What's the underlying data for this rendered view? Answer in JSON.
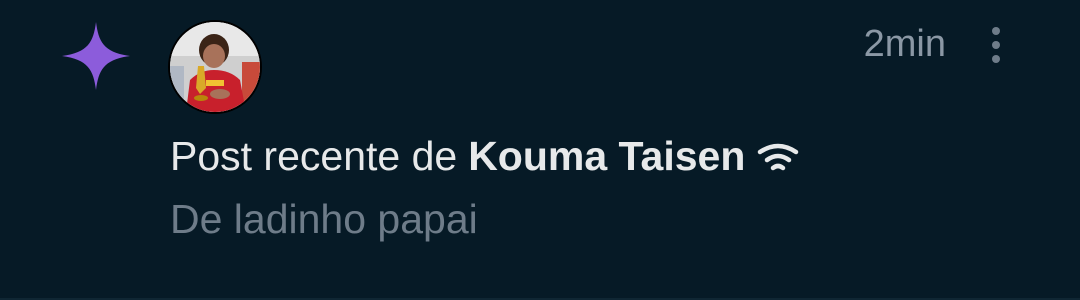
{
  "notification": {
    "type_icon": "sparkle-star-icon",
    "accent_color": "#8c5cdb",
    "avatar_alt": "profile-photo",
    "time": "2min",
    "menu_icon": "more-vertical-icon",
    "title_prefix": "Post recente de",
    "author_name": "Kouma Taisen",
    "author_badge_icon": "broadcast-icon",
    "preview_text": "De ladinho papai"
  }
}
